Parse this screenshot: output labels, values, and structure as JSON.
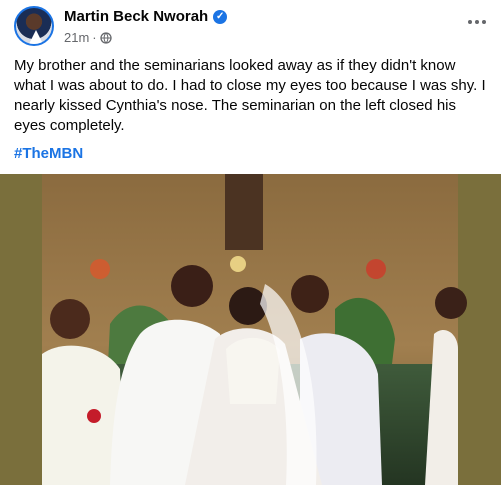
{
  "post": {
    "author": "Martin Beck Nworah",
    "timestamp": "21m",
    "separator": "·",
    "caption": "My brother and the seminarians looked away as if they didn't know what I was about to do. I had to close my eyes too because I was shy. I nearly kissed Cynthia's nose. The seminarian on the left closed his eyes completely.",
    "hashtag": "#TheMBN",
    "photo_alt": "Wedding kiss photo"
  },
  "icons": {
    "verified": "verified-badge-icon",
    "audience": "globe-icon",
    "menu": "more-options-icon"
  },
  "colors": {
    "accent": "#1b74e4",
    "meta_text": "#65676b",
    "photo_frame": "#7a6f3c"
  }
}
